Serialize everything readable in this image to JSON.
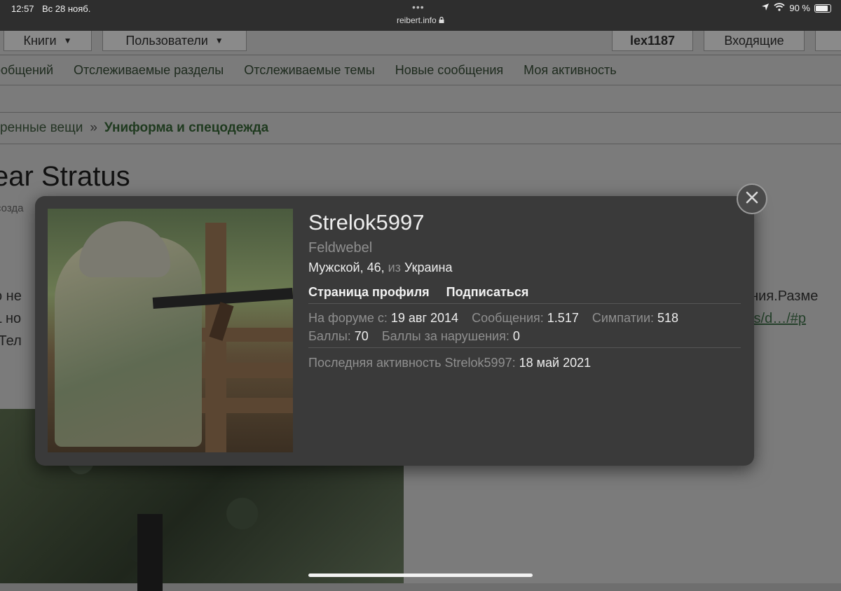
{
  "status_bar": {
    "time": "12:57",
    "date": "Вс 28 нояб.",
    "dots": "•••",
    "url": "reibert.info",
    "battery": "90 %"
  },
  "nav": {
    "tabs": [
      {
        "label": "Книги"
      },
      {
        "label": "Пользователи"
      },
      {
        "label": "lex1187"
      },
      {
        "label": "Входящие"
      }
    ]
  },
  "subnav": {
    "items": [
      "ообщений",
      "Отслеживаемые разделы",
      "Отслеживаемые темы",
      "Новые сообщения",
      "Моя активность"
    ]
  },
  "breadcrumb": {
    "prev": "ренные вещи",
    "separator": "»",
    "current": "Униформа и спецодежда"
  },
  "thread": {
    "title": "ear Stratus",
    "subtitle": "созда",
    "left_lines": [
      "о не",
      "L но",
      ".Тел"
    ],
    "right_lines": [
      "ания.Разме",
      "cts/d…/#p"
    ]
  },
  "profile": {
    "username": "Strelok5997",
    "rank": "Feldwebel",
    "gender_age": "Мужской, 46,",
    "from_label": "из",
    "country": "Украина",
    "profile_link": "Страница профиля",
    "subscribe_link": "Подписаться",
    "stats": {
      "forum_since_label": "На форуме с:",
      "forum_since": "19 авг 2014",
      "messages_label": "Сообщения:",
      "messages": "1.517",
      "likes_label": "Симпатии:",
      "likes": "518",
      "points_label": "Баллы:",
      "points": "70",
      "violations_label": "Баллы за нарушения:",
      "violations": "0",
      "last_activity_label": "Последняя активность Strelok5997:",
      "last_activity": "18 май 2021"
    }
  }
}
